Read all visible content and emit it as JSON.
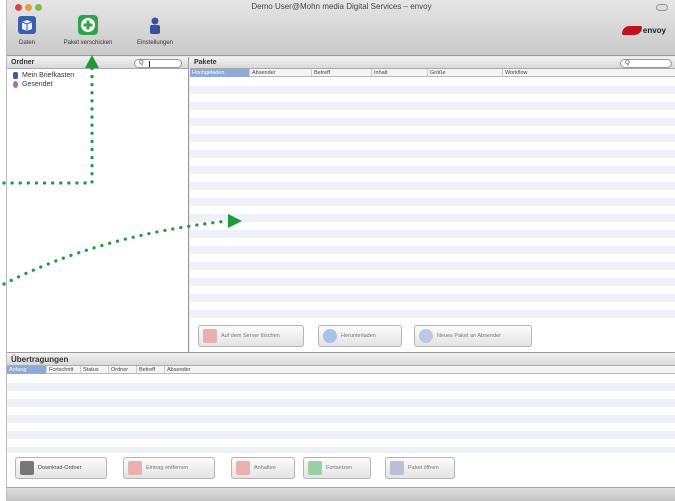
{
  "window": {
    "title": "Demo User@Mohn media Digital Services – envoy"
  },
  "toolbar": {
    "daten_label": "Daten",
    "paket_label": "Paket verschicken",
    "einstellungen_label": "Einstellungen",
    "logo_text": "envoy"
  },
  "left_pane": {
    "header": "Ordner",
    "search_glyph": "Q",
    "items": [
      {
        "label": "Mein Briefkasten",
        "icon": "person-icon",
        "color": "#3b5aa8"
      },
      {
        "label": "Gesendet",
        "icon": "sent-icon",
        "color": "#9b6fc4"
      }
    ]
  },
  "right_pane": {
    "header": "Pakete",
    "search_glyph": "Q",
    "columns": [
      "Hochgeladen",
      "Absender",
      "Betreff",
      "Inhalt",
      "Größe",
      "Workflow"
    ],
    "buttons": [
      "Auf dem Server löschen",
      "Herunterladen",
      "Neues Paket an Absender"
    ]
  },
  "transfers": {
    "header": "Übertragungen",
    "columns": [
      "Anfang",
      "Fortschritt",
      "Status",
      "Ordner",
      "Betreff",
      "Absender"
    ],
    "buttons": [
      "Download-Ordner",
      "Eintrag entfernen",
      "Anhalten",
      "Fortsetzen",
      "Paket öffnen"
    ]
  },
  "colors": {
    "accent_green": "#2fa44a",
    "annotation_green": "#1f9a3a",
    "selection_blue": "#8fa9d8",
    "logo_red": "#c1121f"
  }
}
